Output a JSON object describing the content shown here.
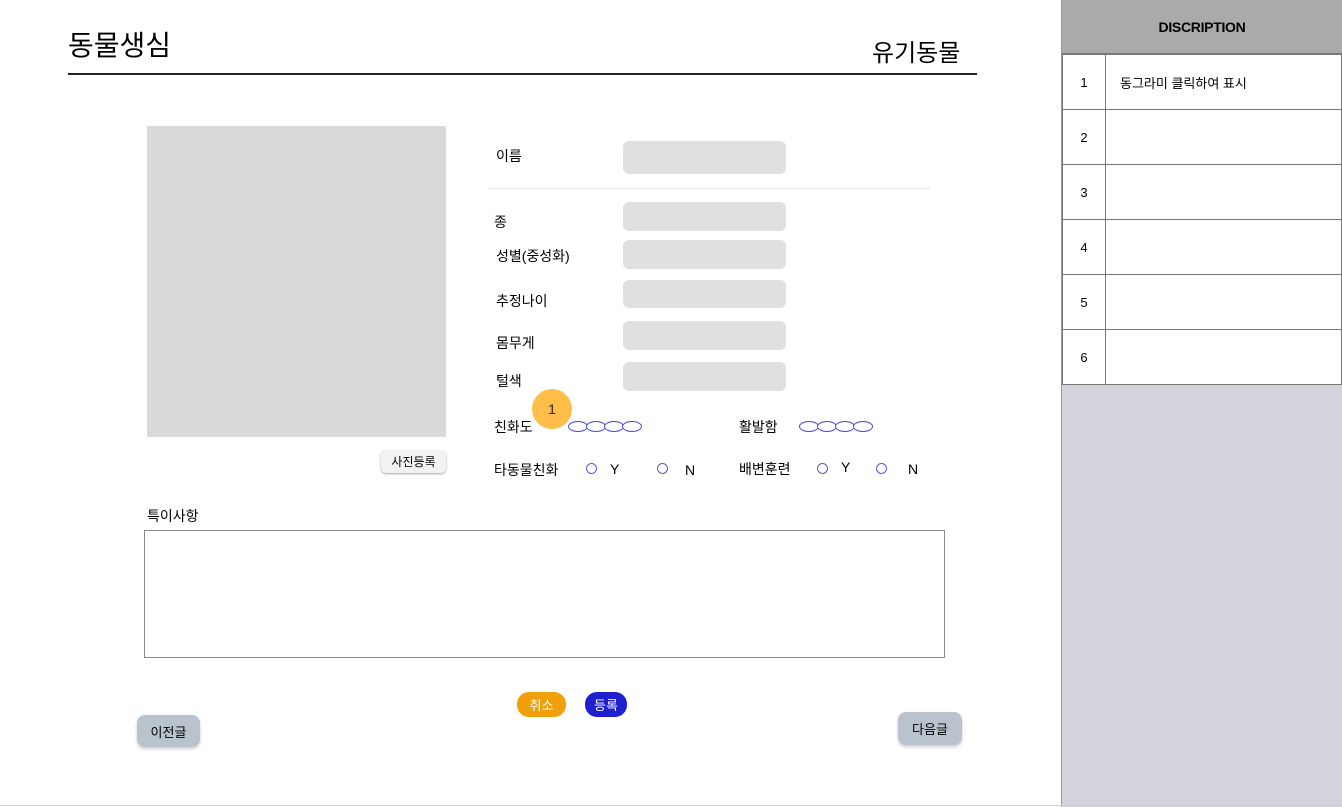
{
  "header": {
    "brand": "동물생심",
    "category": "유기동물"
  },
  "form": {
    "photo_button": "사진등록",
    "fields": {
      "name_label": "이름",
      "species_label": "종",
      "sex_label": "성별(중성화)",
      "age_label": "추정나이",
      "weight_label": "몸무게",
      "color_label": "털색"
    },
    "ratings": {
      "friendliness_label": "친화도",
      "activity_label": "활발함"
    },
    "yes_no": {
      "other_animals_label": "타동물친화",
      "potty_label": "배변훈련",
      "yes": "Y",
      "no": "N"
    },
    "notes_label": "특이사항",
    "marker": "1"
  },
  "actions": {
    "cancel": "취소",
    "submit": "등록",
    "prev": "이전글",
    "next": "다음글"
  },
  "panel": {
    "title": "DISCRIPTION",
    "rows": [
      {
        "num": "1",
        "text": "동그라미 클릭하여 표시"
      },
      {
        "num": "2",
        "text": ""
      },
      {
        "num": "3",
        "text": ""
      },
      {
        "num": "4",
        "text": ""
      },
      {
        "num": "5",
        "text": ""
      },
      {
        "num": "6",
        "text": ""
      }
    ]
  },
  "colors": {
    "cancel": "#f0a00a",
    "submit": "#1f1fd0",
    "marker": "#ffbd4a",
    "panel": "#d3d3dc"
  }
}
